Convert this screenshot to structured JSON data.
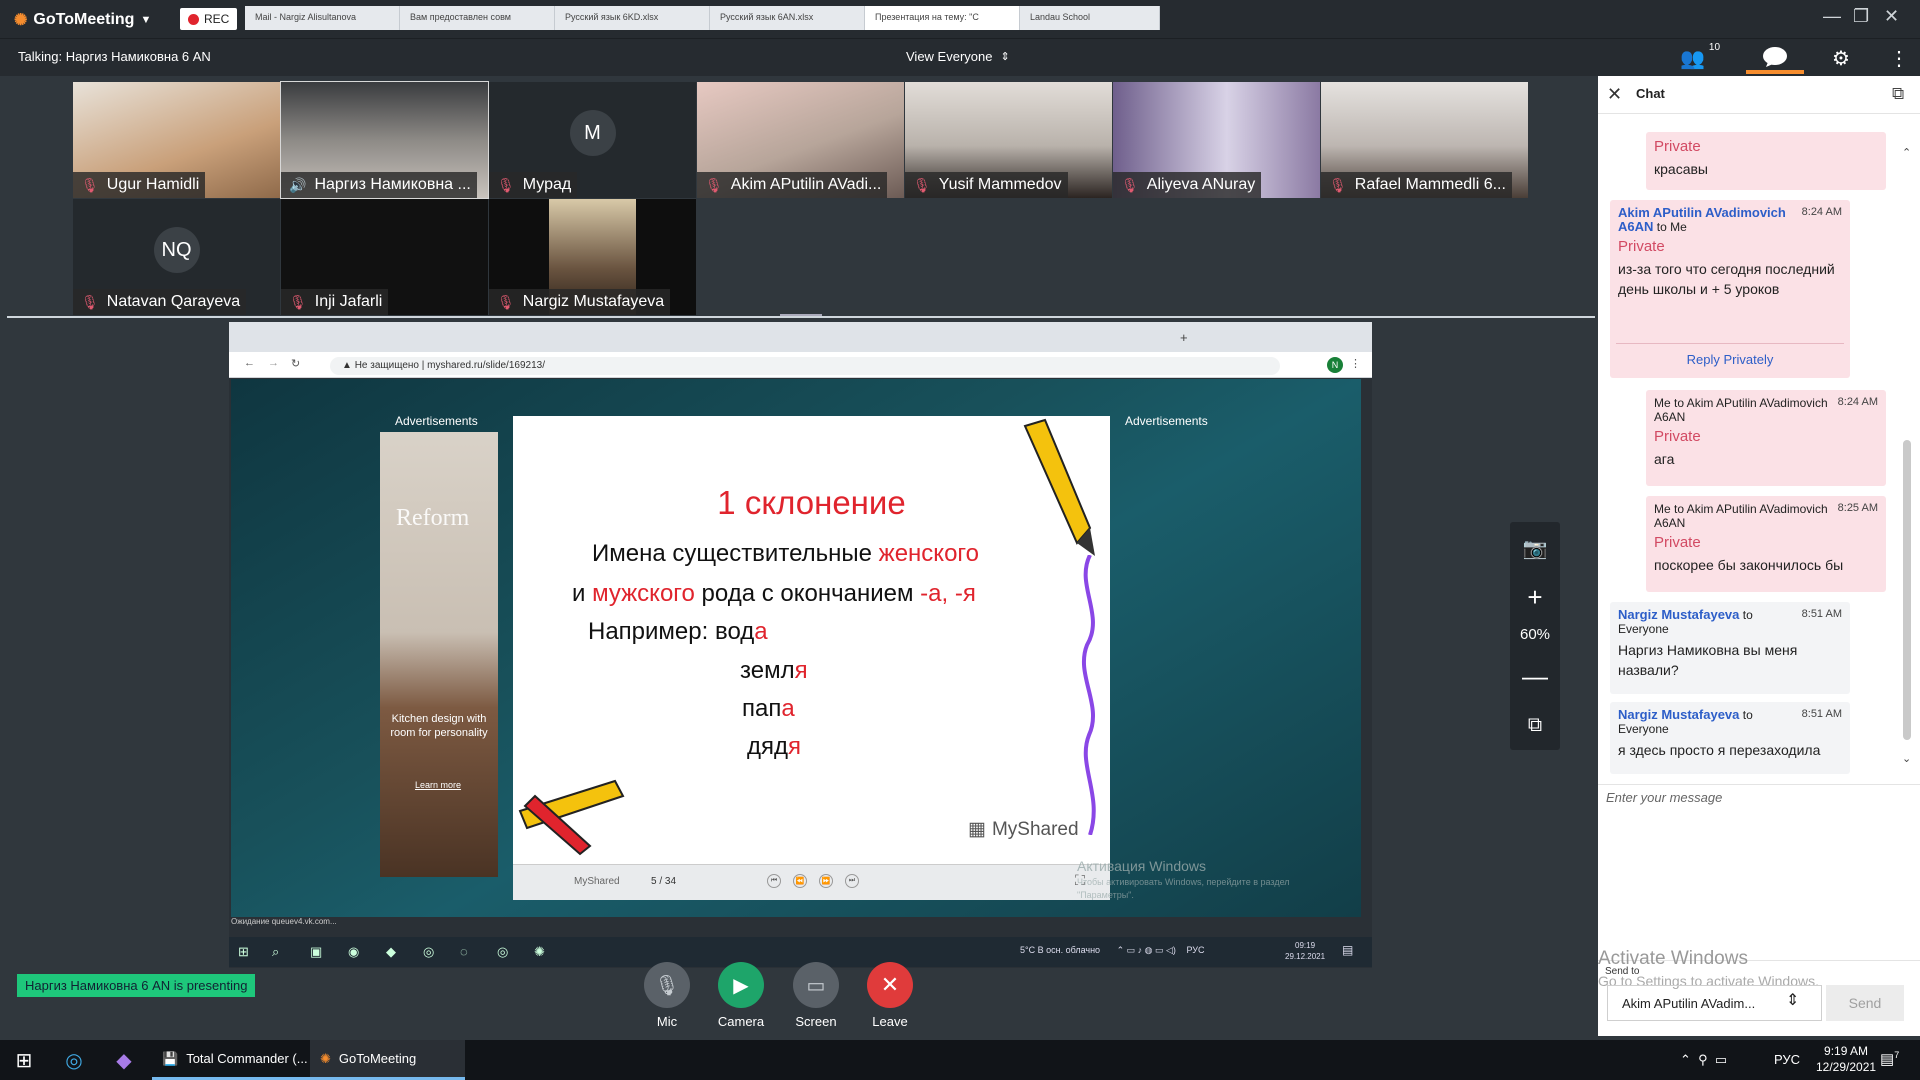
{
  "app": {
    "name": "GoToMeeting",
    "rec_label": "REC"
  },
  "talking": "Talking: Наргиз Намиковна 6 AN",
  "view": "View Everyone",
  "participants_count": "10",
  "participants": [
    {
      "name": "Ugur Hamidli",
      "muted": true,
      "color": "#c9a07a"
    },
    {
      "name": "Наргиз Намиковна ...",
      "muted": false,
      "color": "#8d8a86"
    },
    {
      "name": "Мурад",
      "muted": true,
      "initial": "M"
    },
    {
      "name": "Akim APutilin AVadi...",
      "muted": true,
      "color": "#b7a59a"
    },
    {
      "name": "Yusif Mammedov",
      "muted": true,
      "color": "#b9b2ab"
    },
    {
      "name": "Aliyeva ANuray",
      "muted": true,
      "color": "#8b7aa3"
    },
    {
      "name": "Rafael Mammedli 6...",
      "muted": true,
      "color": "#bdb6b1"
    },
    {
      "name": "Natavan Qarayeva",
      "muted": true,
      "initial": "NQ"
    },
    {
      "name": "Inji Jafarli",
      "muted": true,
      "color": "#111111"
    },
    {
      "name": "Nargiz Mustafayeva",
      "muted": true,
      "color": "#3b3026"
    }
  ],
  "browser": {
    "tabs": [
      "Mail - Nargiz Alisultanova",
      "Вам предоставлен совм",
      "Русский язык 6KD.xlsx",
      "Русский язык 6AN.xlsx",
      "Презентация на тему: \"С",
      "Landau School"
    ],
    "url_warning": "Не защищено",
    "url": "myshared.ru/slide/169213/",
    "profile_initial": "N",
    "status": "Ожидание queuev4.vk.com..."
  },
  "ads": {
    "label": "Advertisements",
    "brand": "Reform",
    "text": "Kitchen design with room for personality",
    "link": "Learn more"
  },
  "slide": {
    "title": "1 склонение",
    "line1_a": "Имена существительные ",
    "line1_b": "женского",
    "line2_a": "и ",
    "line2_b": "мужского",
    "line2_c": " рода с окончанием  ",
    "line2_d": "-а, -я",
    "line3_a": "Например: вод",
    "line3_b": "а",
    "ex1_a": "земл",
    "ex1_b": "я",
    "ex2_a": "пап",
    "ex2_b": "а",
    "ex3_a": "дяд",
    "ex3_b": "я",
    "brand": "MyShared",
    "ctrl_brand": "MyShared",
    "page": "5 / 34"
  },
  "inner_windows": {
    "watermark_title": "Активация Windows",
    "watermark_text": "Чтобы активировать Windows, перейдите в раздел \"Параметры\".",
    "weather": "5°C  В осн. облачно",
    "lang": "РУС",
    "time": "09:19",
    "date": "29.12.2021"
  },
  "zoom": "60%",
  "presenting": "Наргиз Намиковна 6 AN is presenting",
  "controls": {
    "mic": "Mic",
    "camera": "Camera",
    "screen": "Screen",
    "leave": "Leave"
  },
  "chat": {
    "title": "Chat",
    "messages": [
      {
        "private": "Private",
        "text": "красавы"
      },
      {
        "sender": "Akim APutilin AVadimovich A6AN",
        "to": "to Me",
        "time": "8:24 AM",
        "private": "Private",
        "text": "из-за того что сегодня последний день школы и + 5 уроков",
        "reply": "Reply Privately"
      },
      {
        "meta": "Me to Akim APutilin AVadimovich A6AN",
        "time": "8:24 AM",
        "private": "Private",
        "text": "ага"
      },
      {
        "meta": "Me to Akim APutilin AVadimovich A6AN",
        "time": "8:25 AM",
        "private": "Private",
        "text": "поскорее бы закончилось бы"
      },
      {
        "sender": "Nargiz Mustafayeva",
        "to": "to Everyone",
        "time": "8:51 AM",
        "text": "Наргиз Намиковна вы меня назвали?"
      },
      {
        "sender": "Nargiz Mustafayeva",
        "to": "to Everyone",
        "time": "8:51 AM",
        "text": "я здесь просто я перезаходила"
      }
    ],
    "placeholder": "Enter your message",
    "send_to_label": "Send to",
    "send_to": "Akim  APutilin  AVadim...",
    "send": "Send",
    "activate_title": "Activate Windows",
    "activate_text": "Go to Settings to activate Windows."
  },
  "taskbar": {
    "apps": [
      "Total Commander (...",
      "GoToMeeting"
    ],
    "lang": "РУС",
    "time": "9:19 AM",
    "date": "12/29/2021",
    "notif_count": "7"
  }
}
